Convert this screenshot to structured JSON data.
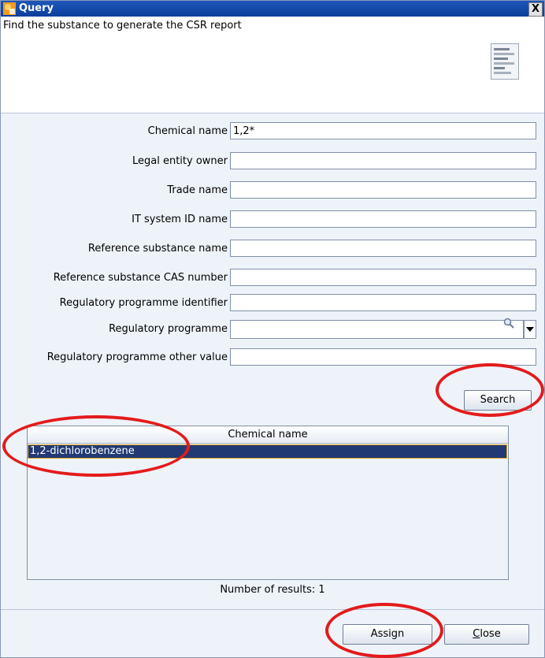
{
  "window": {
    "title": "Query",
    "close_glyph": "X",
    "icons": [
      "app-icon",
      "close-icon"
    ]
  },
  "header": {
    "description": "Find the substance to generate the CSR report",
    "icon": "document-icon"
  },
  "form": {
    "fields": [
      {
        "label": "Chemical name",
        "value": "1,2*"
      },
      {
        "label": "Legal entity owner",
        "value": ""
      },
      {
        "label": "Trade name",
        "value": ""
      },
      {
        "label": "IT system ID name",
        "value": ""
      },
      {
        "label": "Reference substance name",
        "value": ""
      },
      {
        "label": "Reference substance CAS number",
        "value": ""
      },
      {
        "label": "Regulatory programme identifier",
        "value": ""
      },
      {
        "label": "Regulatory programme",
        "value": ""
      },
      {
        "label": "Regulatory programme other value",
        "value": ""
      }
    ],
    "search_button": "Search"
  },
  "results": {
    "column_header": "Chemical name",
    "rows": [
      "1,2-dichlorobenzene"
    ],
    "count_text": "Number of results: 1"
  },
  "footer": {
    "assign_button": "Assign",
    "close_button_first": "C",
    "close_button_rest": "lose"
  },
  "colors": {
    "title_bar": "#0b3f9c",
    "window_bg": "#eef3fa",
    "selection": "#213a73",
    "annotation": "#e31b1b"
  }
}
